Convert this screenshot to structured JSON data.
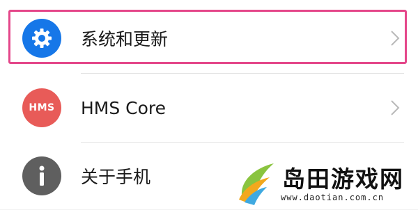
{
  "menu": {
    "items": [
      {
        "label": "系统和更新",
        "icon": "settings-gear-icon",
        "icon_color": "#1677e8",
        "highlighted": true
      },
      {
        "label": "HMS Core",
        "icon": "hms-logo-icon",
        "icon_text": "HMS",
        "icon_color": "#e85b58"
      },
      {
        "label": "关于手机",
        "icon": "info-icon",
        "icon_color": "#5f5f5f"
      }
    ]
  },
  "highlight_color": "#e4478a",
  "watermark": {
    "text": "岛田游戏网",
    "url": "www.daotian.com.cn"
  }
}
